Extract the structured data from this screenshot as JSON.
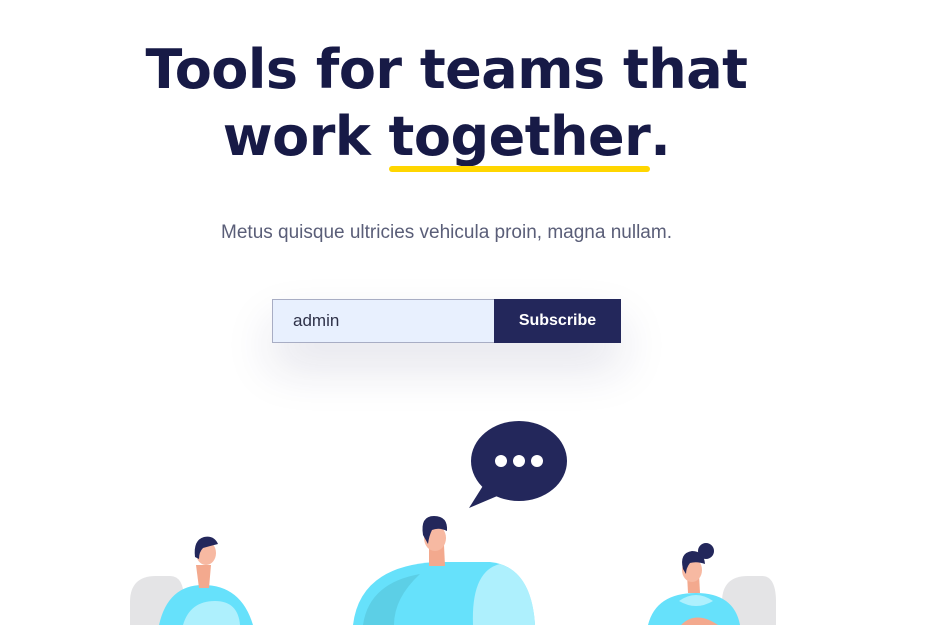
{
  "hero": {
    "title_line1": "Tools for teams that",
    "title_line2_prefix": "work ",
    "title_highlight": "together",
    "title_suffix": "."
  },
  "subtitle": "Metus quisque ultricies vehicula proin, magna nullam.",
  "subscribe": {
    "input_value": "admin",
    "button_label": "Subscribe"
  },
  "colors": {
    "heading": "#171a46",
    "highlight_underline": "#ffd600",
    "button_bg": "#23275b",
    "input_bg": "#e8f0fe",
    "figure_blue": "#66e1fb",
    "figure_navy": "#23275b"
  },
  "illustration": {
    "speech_bubble_icon": "chat-ellipsis-icon"
  }
}
